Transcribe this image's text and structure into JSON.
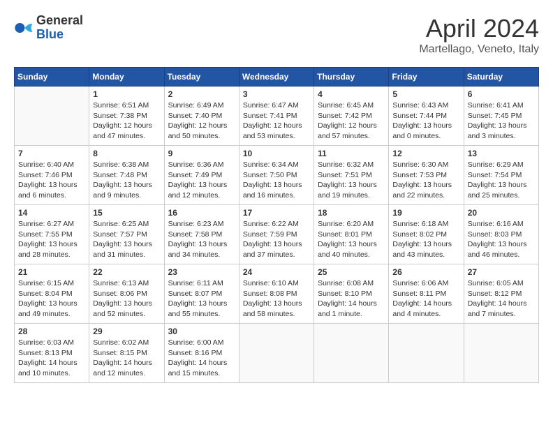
{
  "header": {
    "logo_general": "General",
    "logo_blue": "Blue",
    "month_title": "April 2024",
    "location": "Martellago, Veneto, Italy"
  },
  "days_of_week": [
    "Sunday",
    "Monday",
    "Tuesday",
    "Wednesday",
    "Thursday",
    "Friday",
    "Saturday"
  ],
  "weeks": [
    [
      {
        "day": "",
        "info": ""
      },
      {
        "day": "1",
        "info": "Sunrise: 6:51 AM\nSunset: 7:38 PM\nDaylight: 12 hours\nand 47 minutes."
      },
      {
        "day": "2",
        "info": "Sunrise: 6:49 AM\nSunset: 7:40 PM\nDaylight: 12 hours\nand 50 minutes."
      },
      {
        "day": "3",
        "info": "Sunrise: 6:47 AM\nSunset: 7:41 PM\nDaylight: 12 hours\nand 53 minutes."
      },
      {
        "day": "4",
        "info": "Sunrise: 6:45 AM\nSunset: 7:42 PM\nDaylight: 12 hours\nand 57 minutes."
      },
      {
        "day": "5",
        "info": "Sunrise: 6:43 AM\nSunset: 7:44 PM\nDaylight: 13 hours\nand 0 minutes."
      },
      {
        "day": "6",
        "info": "Sunrise: 6:41 AM\nSunset: 7:45 PM\nDaylight: 13 hours\nand 3 minutes."
      }
    ],
    [
      {
        "day": "7",
        "info": "Sunrise: 6:40 AM\nSunset: 7:46 PM\nDaylight: 13 hours\nand 6 minutes."
      },
      {
        "day": "8",
        "info": "Sunrise: 6:38 AM\nSunset: 7:48 PM\nDaylight: 13 hours\nand 9 minutes."
      },
      {
        "day": "9",
        "info": "Sunrise: 6:36 AM\nSunset: 7:49 PM\nDaylight: 13 hours\nand 12 minutes."
      },
      {
        "day": "10",
        "info": "Sunrise: 6:34 AM\nSunset: 7:50 PM\nDaylight: 13 hours\nand 16 minutes."
      },
      {
        "day": "11",
        "info": "Sunrise: 6:32 AM\nSunset: 7:51 PM\nDaylight: 13 hours\nand 19 minutes."
      },
      {
        "day": "12",
        "info": "Sunrise: 6:30 AM\nSunset: 7:53 PM\nDaylight: 13 hours\nand 22 minutes."
      },
      {
        "day": "13",
        "info": "Sunrise: 6:29 AM\nSunset: 7:54 PM\nDaylight: 13 hours\nand 25 minutes."
      }
    ],
    [
      {
        "day": "14",
        "info": "Sunrise: 6:27 AM\nSunset: 7:55 PM\nDaylight: 13 hours\nand 28 minutes."
      },
      {
        "day": "15",
        "info": "Sunrise: 6:25 AM\nSunset: 7:57 PM\nDaylight: 13 hours\nand 31 minutes."
      },
      {
        "day": "16",
        "info": "Sunrise: 6:23 AM\nSunset: 7:58 PM\nDaylight: 13 hours\nand 34 minutes."
      },
      {
        "day": "17",
        "info": "Sunrise: 6:22 AM\nSunset: 7:59 PM\nDaylight: 13 hours\nand 37 minutes."
      },
      {
        "day": "18",
        "info": "Sunrise: 6:20 AM\nSunset: 8:01 PM\nDaylight: 13 hours\nand 40 minutes."
      },
      {
        "day": "19",
        "info": "Sunrise: 6:18 AM\nSunset: 8:02 PM\nDaylight: 13 hours\nand 43 minutes."
      },
      {
        "day": "20",
        "info": "Sunrise: 6:16 AM\nSunset: 8:03 PM\nDaylight: 13 hours\nand 46 minutes."
      }
    ],
    [
      {
        "day": "21",
        "info": "Sunrise: 6:15 AM\nSunset: 8:04 PM\nDaylight: 13 hours\nand 49 minutes."
      },
      {
        "day": "22",
        "info": "Sunrise: 6:13 AM\nSunset: 8:06 PM\nDaylight: 13 hours\nand 52 minutes."
      },
      {
        "day": "23",
        "info": "Sunrise: 6:11 AM\nSunset: 8:07 PM\nDaylight: 13 hours\nand 55 minutes."
      },
      {
        "day": "24",
        "info": "Sunrise: 6:10 AM\nSunset: 8:08 PM\nDaylight: 13 hours\nand 58 minutes."
      },
      {
        "day": "25",
        "info": "Sunrise: 6:08 AM\nSunset: 8:10 PM\nDaylight: 14 hours\nand 1 minute."
      },
      {
        "day": "26",
        "info": "Sunrise: 6:06 AM\nSunset: 8:11 PM\nDaylight: 14 hours\nand 4 minutes."
      },
      {
        "day": "27",
        "info": "Sunrise: 6:05 AM\nSunset: 8:12 PM\nDaylight: 14 hours\nand 7 minutes."
      }
    ],
    [
      {
        "day": "28",
        "info": "Sunrise: 6:03 AM\nSunset: 8:13 PM\nDaylight: 14 hours\nand 10 minutes."
      },
      {
        "day": "29",
        "info": "Sunrise: 6:02 AM\nSunset: 8:15 PM\nDaylight: 14 hours\nand 12 minutes."
      },
      {
        "day": "30",
        "info": "Sunrise: 6:00 AM\nSunset: 8:16 PM\nDaylight: 14 hours\nand 15 minutes."
      },
      {
        "day": "",
        "info": ""
      },
      {
        "day": "",
        "info": ""
      },
      {
        "day": "",
        "info": ""
      },
      {
        "day": "",
        "info": ""
      }
    ]
  ]
}
